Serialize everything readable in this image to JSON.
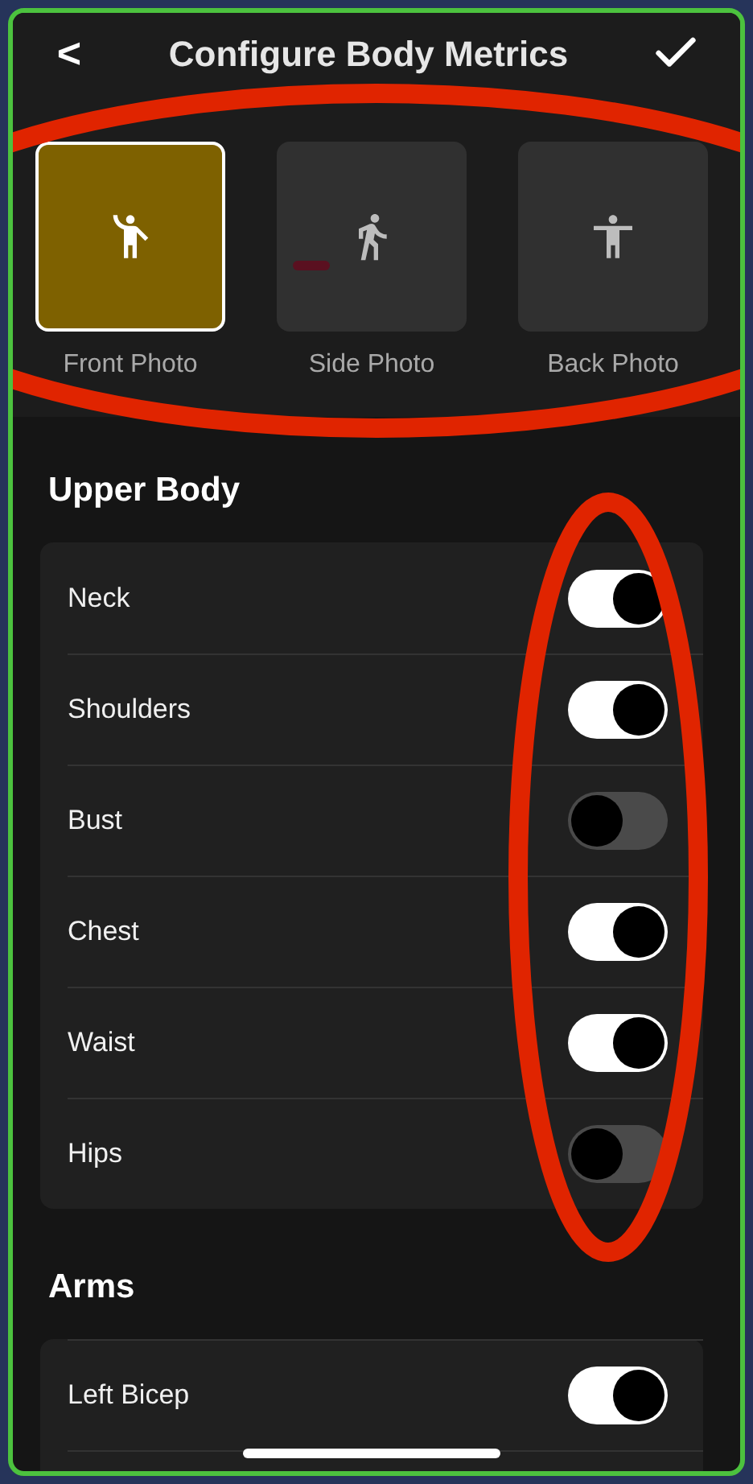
{
  "header": {
    "back": "<",
    "title": "Configure Body Metrics"
  },
  "photos": [
    {
      "label": "Front Photo",
      "selected": true
    },
    {
      "label": "Side Photo",
      "selected": false
    },
    {
      "label": "Back Photo",
      "selected": false
    }
  ],
  "sections": [
    {
      "title": "Upper Body",
      "items": [
        {
          "label": "Neck",
          "on": true
        },
        {
          "label": "Shoulders",
          "on": true
        },
        {
          "label": "Bust",
          "on": false
        },
        {
          "label": "Chest",
          "on": true
        },
        {
          "label": "Waist",
          "on": true
        },
        {
          "label": "Hips",
          "on": false
        }
      ]
    },
    {
      "title": "Arms",
      "items": [
        {
          "label": "Left Bicep",
          "on": true
        }
      ]
    }
  ],
  "annotations": [
    {
      "kind": "ellipse"
    },
    {
      "kind": "ellipse"
    }
  ]
}
